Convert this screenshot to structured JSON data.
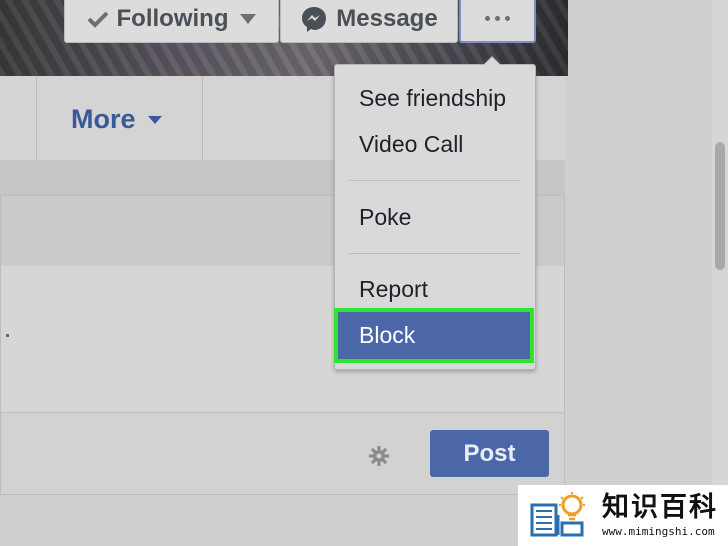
{
  "cover": {
    "following_label": "Following",
    "message_label": "Message"
  },
  "nav": {
    "more_label": "More"
  },
  "composer": {
    "post_label": "Post"
  },
  "menu": {
    "items": [
      {
        "label": "See friendship"
      },
      {
        "label": "Video Call"
      },
      {
        "label": "Poke"
      },
      {
        "label": "Report"
      },
      {
        "label": "Block"
      }
    ],
    "highlighted_item": "Block"
  },
  "watermark": {
    "brand_cn": "知识百科",
    "url": "www.mimingshi.com"
  },
  "colors": {
    "accent": "#3b5998",
    "button_blue": "#4b67a8",
    "highlight_green": "#2ee42e"
  },
  "icons": [
    "check-icon",
    "chevron-down-icon",
    "messenger-icon",
    "more-dots-icon",
    "gear-icon",
    "book-lightbulb-logo-icon"
  ]
}
